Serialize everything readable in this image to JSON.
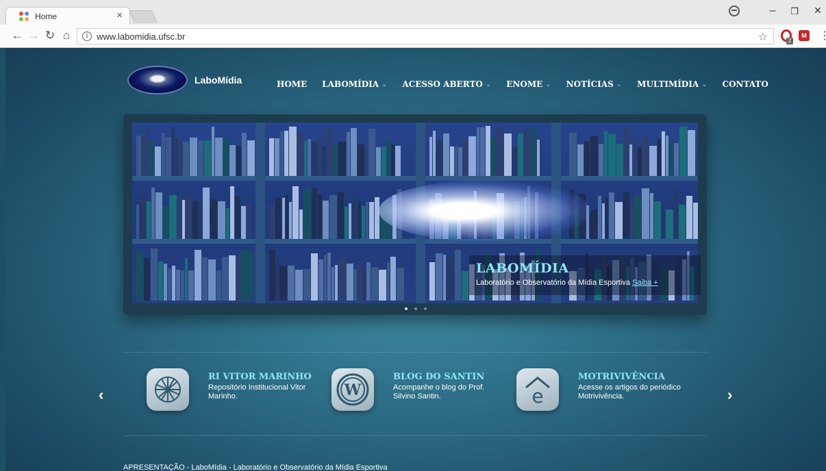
{
  "browser": {
    "tab_title": "Home",
    "tab_close": "×",
    "url": "www.labomidia.ufsc.br",
    "ext_badge": "2",
    "window_minimize": "–",
    "window_restore": "❐",
    "window_close": "✕"
  },
  "site": {
    "logo_text": "LaboMídia",
    "menu": [
      {
        "label": "HOME",
        "has_dropdown": false
      },
      {
        "label": "LABOMÍDIA",
        "has_dropdown": true
      },
      {
        "label": "ACESSO ABERTO",
        "has_dropdown": true
      },
      {
        "label": "ENOME",
        "has_dropdown": true
      },
      {
        "label": "NOTÍCIAS",
        "has_dropdown": true
      },
      {
        "label": "MULTIMÍDIA",
        "has_dropdown": true
      },
      {
        "label": "CONTATO",
        "has_dropdown": false
      }
    ],
    "slider": {
      "title": "LABOMÍDIA",
      "text": "Laboratório e Observatório da Mídia Esportiva",
      "link": "Saiba +",
      "dot_count": 3,
      "active_dot": 0
    },
    "features": [
      {
        "title": "RI VITOR MARINHO",
        "desc": "Repositório Institucional Vitor Marinho.",
        "icon": "network-icon"
      },
      {
        "title": "BLOG DO SANTIN",
        "desc": "Acompanhe o blog do Prof. Silvino Santin.",
        "icon": "wordpress-icon"
      },
      {
        "title": "MOTRIVIVÊNCIA",
        "desc": "Acesse os artigos do periódico Motrivivência.",
        "icon": "journal-icon"
      }
    ],
    "arrow_prev": "‹",
    "arrow_next": "›",
    "footer": "APRESENTAÇÃO - LaboMídia - Laboratório e Observatório da Mídia Esportiva"
  },
  "colors": {
    "accent": "#8fe6f5",
    "page_bg": "#2a6780",
    "slider_frame": "#1d3d4e"
  }
}
